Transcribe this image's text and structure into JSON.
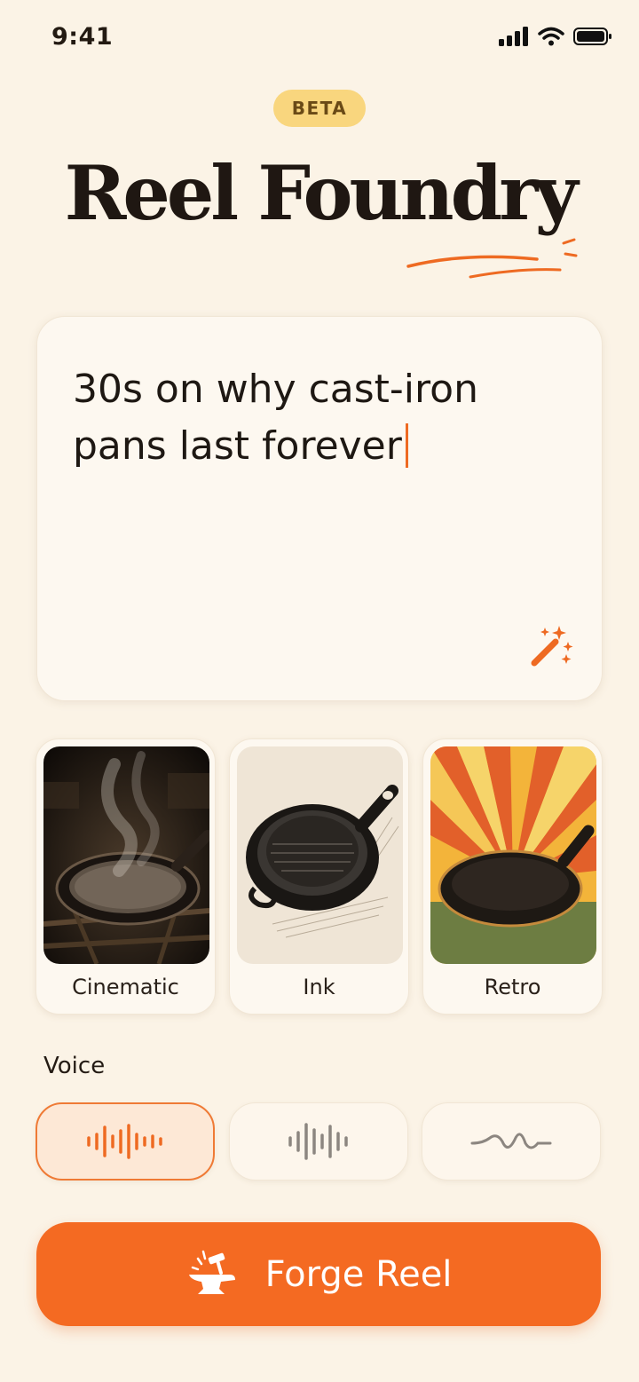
{
  "status": {
    "time": "9:41"
  },
  "badge": "BETA",
  "app": {
    "title": "Reel Foundry"
  },
  "prompt": {
    "text": "30s on why cast-iron pans last forever"
  },
  "styles": [
    {
      "label": "Cinematic",
      "selected": false
    },
    {
      "label": "Ink",
      "selected": false
    },
    {
      "label": "Retro",
      "selected": false
    }
  ],
  "voice": {
    "label": "Voice",
    "options": [
      {
        "icon": "waveform-bars-icon",
        "selected": true
      },
      {
        "icon": "waveform-bars-icon",
        "selected": false
      },
      {
        "icon": "sine-wave-icon",
        "selected": false
      }
    ]
  },
  "cta": {
    "label": "Forge Reel",
    "icon": "anvil-hammer-icon"
  },
  "colors": {
    "accent": "#f46a22",
    "background": "#fbf3e6",
    "badge": "#f9d67e"
  }
}
